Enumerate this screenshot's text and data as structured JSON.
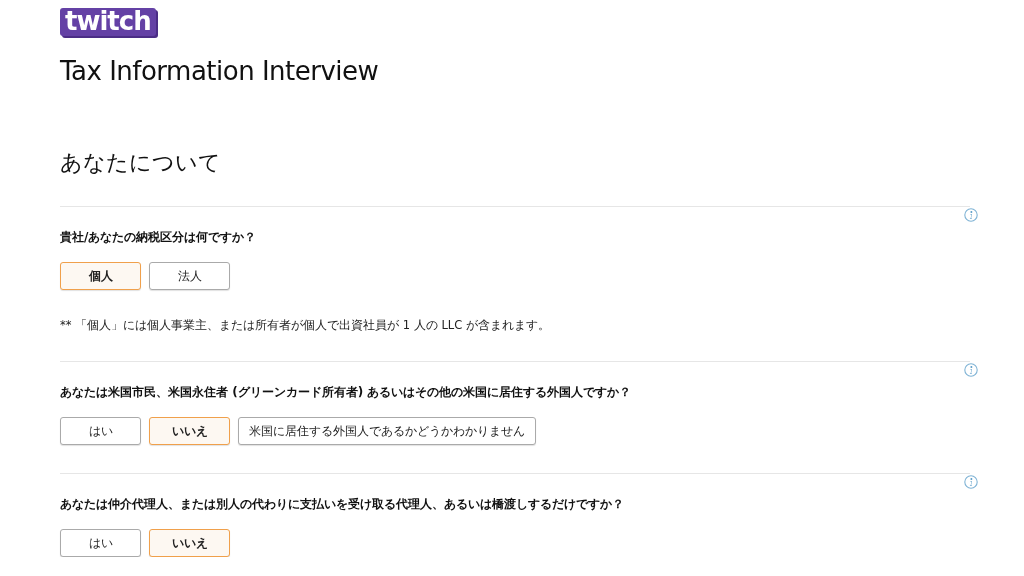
{
  "logo": "twitch",
  "title": "Tax Information Interview",
  "section_heading": "あなたについて",
  "questions": [
    {
      "text": "貴社/あなたの納税区分は何ですか？",
      "options": [
        {
          "label": "個人",
          "selected": true
        },
        {
          "label": "法人",
          "selected": false
        }
      ],
      "note": "** 「個人」には個人事業主、または所有者が個人で出資社員が 1 人の LLC が含まれます。"
    },
    {
      "text": "あなたは米国市民、米国永住者 (グリーンカード所有者) あるいはその他の米国に居住する外国人ですか？",
      "options": [
        {
          "label": "はい",
          "selected": false
        },
        {
          "label": "いいえ",
          "selected": true
        },
        {
          "label": "米国に居住する外国人であるかどうかわかりません",
          "selected": false
        }
      ]
    },
    {
      "text": "あなたは仲介代理人、または別人の代わりに支払いを受け取る代理人、あるいは橋渡しするだけですか？",
      "options": [
        {
          "label": "はい",
          "selected": false
        },
        {
          "label": "いいえ",
          "selected": true
        }
      ]
    }
  ]
}
